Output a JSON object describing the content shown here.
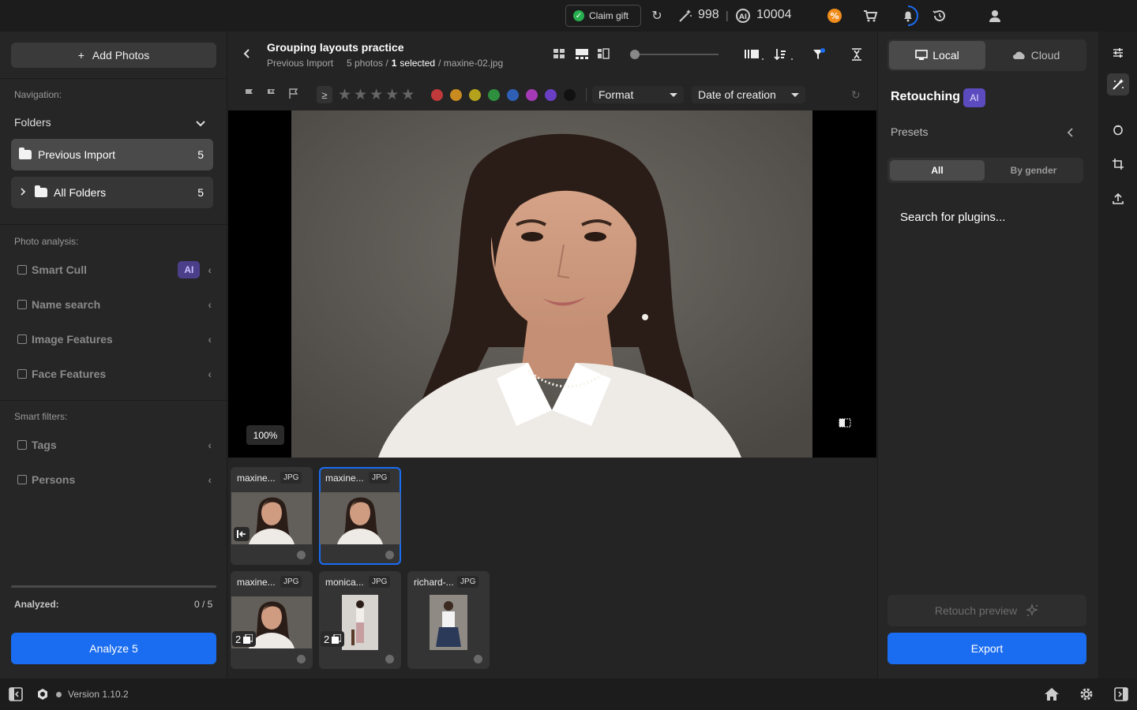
{
  "topbar": {
    "claim_gift": "Claim gift",
    "credits_1": "998",
    "separator": "|",
    "credits_2": "10004",
    "icons": [
      "refresh-icon",
      "magic-wand-icon",
      "ai-credits-icon",
      "discount-badge-icon",
      "cart-icon",
      "notifications-icon",
      "history-icon",
      "user-icon"
    ]
  },
  "left": {
    "add_photos": "Add Photos",
    "add_symbol": "+",
    "navigation_label": "Navigation:",
    "folders_label": "Folders",
    "folders": [
      {
        "name": "Previous Import",
        "count": "5"
      },
      {
        "name": "All Folders",
        "count": "5"
      }
    ],
    "photo_analysis_label": "Photo analysis:",
    "analysis_items": [
      {
        "label": "Smart Cull",
        "badge": "AI"
      },
      {
        "label": "Name search"
      },
      {
        "label": "Image Features"
      },
      {
        "label": "Face Features"
      }
    ],
    "smart_filters_label": "Smart filters:",
    "smart_filters": [
      {
        "label": "Tags"
      },
      {
        "label": "Persons"
      }
    ],
    "analyzed_label": "Analyzed:",
    "analyzed_value": "0 / 5",
    "analyzed_fraction": 0,
    "analyze_button": "Analyze 5"
  },
  "center": {
    "title": "Grouping layouts practice",
    "subtitle_folder": "Previous Import",
    "subtitle_count": "5 photos /",
    "subtitle_selected_num": "1",
    "subtitle_selected_word": "selected",
    "subtitle_file": "/ maxine-02.jpg",
    "rating_operator": "≥",
    "color_labels": [
      "#c0393b",
      "#c98b20",
      "#b5a21c",
      "#2e8f3e",
      "#2f5fb5",
      "#a43ab5",
      "#6a3fc4",
      "#111111"
    ],
    "format_dropdown": "Format",
    "sort_dropdown": "Date of creation",
    "zoom": "100%",
    "thumbnails": [
      {
        "name": "maxine...",
        "type": "JPG",
        "stack": ""
      },
      {
        "name": "maxine...",
        "type": "JPG",
        "stack": "",
        "selected": true
      },
      {
        "name": "maxine...",
        "type": "JPG",
        "stack": "2"
      },
      {
        "name": "monica...",
        "type": "JPG",
        "stack": "2"
      },
      {
        "name": "richard-...",
        "type": "JPG",
        "stack": ""
      }
    ]
  },
  "right": {
    "local": "Local",
    "cloud": "Cloud",
    "retouching": "Retouching",
    "ai_badge": "AI",
    "presets": "Presets",
    "seg_all": "All",
    "seg_gender": "By gender",
    "search_plugins": "Search for plugins...",
    "retouch_preview": "Retouch preview",
    "export": "Export"
  },
  "bottom": {
    "version": "Version 1.10.2"
  }
}
